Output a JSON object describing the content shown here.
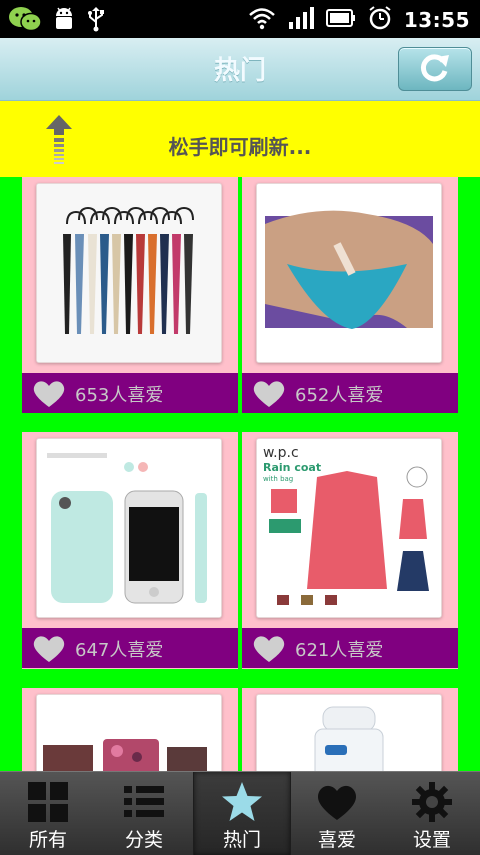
{
  "status_bar": {
    "time": "13:55"
  },
  "header": {
    "title": "热门"
  },
  "pull_to_refresh": {
    "text": "松手即可刷新..."
  },
  "feed": {
    "items": [
      {
        "likes": "653人喜爱",
        "image": "umbrellas-photo"
      },
      {
        "likes": "652人喜爱",
        "image": "bikini-photo"
      },
      {
        "likes": "647人喜爱",
        "image": "phone-case-photo"
      },
      {
        "likes": "621人喜爱",
        "image": "raincoat-photo",
        "image_text": {
          "brand": "w.p.c",
          "headline": "Rain coat",
          "sub": "with bag"
        }
      },
      {
        "image": "soap-bars-photo"
      },
      {
        "image": "bottle-photo"
      }
    ]
  },
  "tabs": [
    {
      "label": "所有",
      "icon": "grid-icon"
    },
    {
      "label": "分类",
      "icon": "list-icon"
    },
    {
      "label": "热门",
      "icon": "star-icon",
      "active": true
    },
    {
      "label": "喜爱",
      "icon": "heart-icon"
    },
    {
      "label": "设置",
      "icon": "gear-icon"
    }
  ],
  "colors": {
    "background": "#00ff00",
    "pull_bar": "#ffff00",
    "cell": "#ffc0cb",
    "like_bar": "#800080",
    "title_bar": "#a6d8df"
  }
}
